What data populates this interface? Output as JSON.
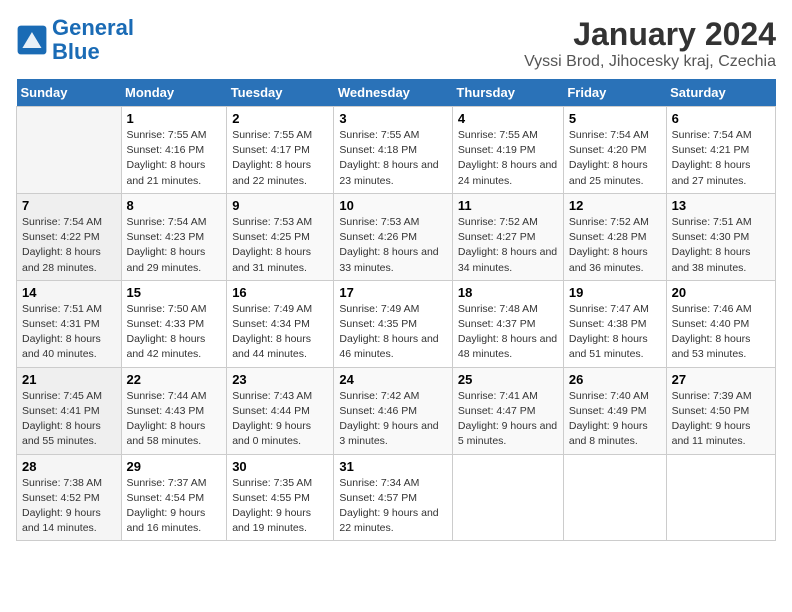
{
  "logo": {
    "line1": "General",
    "line2": "Blue"
  },
  "title": "January 2024",
  "subtitle": "Vyssi Brod, Jihocesky kraj, Czechia",
  "columns": [
    "Sunday",
    "Monday",
    "Tuesday",
    "Wednesday",
    "Thursday",
    "Friday",
    "Saturday"
  ],
  "weeks": [
    [
      {
        "num": "",
        "sunrise": "",
        "sunset": "",
        "daylight": ""
      },
      {
        "num": "1",
        "sunrise": "Sunrise: 7:55 AM",
        "sunset": "Sunset: 4:16 PM",
        "daylight": "Daylight: 8 hours and 21 minutes."
      },
      {
        "num": "2",
        "sunrise": "Sunrise: 7:55 AM",
        "sunset": "Sunset: 4:17 PM",
        "daylight": "Daylight: 8 hours and 22 minutes."
      },
      {
        "num": "3",
        "sunrise": "Sunrise: 7:55 AM",
        "sunset": "Sunset: 4:18 PM",
        "daylight": "Daylight: 8 hours and 23 minutes."
      },
      {
        "num": "4",
        "sunrise": "Sunrise: 7:55 AM",
        "sunset": "Sunset: 4:19 PM",
        "daylight": "Daylight: 8 hours and 24 minutes."
      },
      {
        "num": "5",
        "sunrise": "Sunrise: 7:54 AM",
        "sunset": "Sunset: 4:20 PM",
        "daylight": "Daylight: 8 hours and 25 minutes."
      },
      {
        "num": "6",
        "sunrise": "Sunrise: 7:54 AM",
        "sunset": "Sunset: 4:21 PM",
        "daylight": "Daylight: 8 hours and 27 minutes."
      }
    ],
    [
      {
        "num": "7",
        "sunrise": "Sunrise: 7:54 AM",
        "sunset": "Sunset: 4:22 PM",
        "daylight": "Daylight: 8 hours and 28 minutes."
      },
      {
        "num": "8",
        "sunrise": "Sunrise: 7:54 AM",
        "sunset": "Sunset: 4:23 PM",
        "daylight": "Daylight: 8 hours and 29 minutes."
      },
      {
        "num": "9",
        "sunrise": "Sunrise: 7:53 AM",
        "sunset": "Sunset: 4:25 PM",
        "daylight": "Daylight: 8 hours and 31 minutes."
      },
      {
        "num": "10",
        "sunrise": "Sunrise: 7:53 AM",
        "sunset": "Sunset: 4:26 PM",
        "daylight": "Daylight: 8 hours and 33 minutes."
      },
      {
        "num": "11",
        "sunrise": "Sunrise: 7:52 AM",
        "sunset": "Sunset: 4:27 PM",
        "daylight": "Daylight: 8 hours and 34 minutes."
      },
      {
        "num": "12",
        "sunrise": "Sunrise: 7:52 AM",
        "sunset": "Sunset: 4:28 PM",
        "daylight": "Daylight: 8 hours and 36 minutes."
      },
      {
        "num": "13",
        "sunrise": "Sunrise: 7:51 AM",
        "sunset": "Sunset: 4:30 PM",
        "daylight": "Daylight: 8 hours and 38 minutes."
      }
    ],
    [
      {
        "num": "14",
        "sunrise": "Sunrise: 7:51 AM",
        "sunset": "Sunset: 4:31 PM",
        "daylight": "Daylight: 8 hours and 40 minutes."
      },
      {
        "num": "15",
        "sunrise": "Sunrise: 7:50 AM",
        "sunset": "Sunset: 4:33 PM",
        "daylight": "Daylight: 8 hours and 42 minutes."
      },
      {
        "num": "16",
        "sunrise": "Sunrise: 7:49 AM",
        "sunset": "Sunset: 4:34 PM",
        "daylight": "Daylight: 8 hours and 44 minutes."
      },
      {
        "num": "17",
        "sunrise": "Sunrise: 7:49 AM",
        "sunset": "Sunset: 4:35 PM",
        "daylight": "Daylight: 8 hours and 46 minutes."
      },
      {
        "num": "18",
        "sunrise": "Sunrise: 7:48 AM",
        "sunset": "Sunset: 4:37 PM",
        "daylight": "Daylight: 8 hours and 48 minutes."
      },
      {
        "num": "19",
        "sunrise": "Sunrise: 7:47 AM",
        "sunset": "Sunset: 4:38 PM",
        "daylight": "Daylight: 8 hours and 51 minutes."
      },
      {
        "num": "20",
        "sunrise": "Sunrise: 7:46 AM",
        "sunset": "Sunset: 4:40 PM",
        "daylight": "Daylight: 8 hours and 53 minutes."
      }
    ],
    [
      {
        "num": "21",
        "sunrise": "Sunrise: 7:45 AM",
        "sunset": "Sunset: 4:41 PM",
        "daylight": "Daylight: 8 hours and 55 minutes."
      },
      {
        "num": "22",
        "sunrise": "Sunrise: 7:44 AM",
        "sunset": "Sunset: 4:43 PM",
        "daylight": "Daylight: 8 hours and 58 minutes."
      },
      {
        "num": "23",
        "sunrise": "Sunrise: 7:43 AM",
        "sunset": "Sunset: 4:44 PM",
        "daylight": "Daylight: 9 hours and 0 minutes."
      },
      {
        "num": "24",
        "sunrise": "Sunrise: 7:42 AM",
        "sunset": "Sunset: 4:46 PM",
        "daylight": "Daylight: 9 hours and 3 minutes."
      },
      {
        "num": "25",
        "sunrise": "Sunrise: 7:41 AM",
        "sunset": "Sunset: 4:47 PM",
        "daylight": "Daylight: 9 hours and 5 minutes."
      },
      {
        "num": "26",
        "sunrise": "Sunrise: 7:40 AM",
        "sunset": "Sunset: 4:49 PM",
        "daylight": "Daylight: 9 hours and 8 minutes."
      },
      {
        "num": "27",
        "sunrise": "Sunrise: 7:39 AM",
        "sunset": "Sunset: 4:50 PM",
        "daylight": "Daylight: 9 hours and 11 minutes."
      }
    ],
    [
      {
        "num": "28",
        "sunrise": "Sunrise: 7:38 AM",
        "sunset": "Sunset: 4:52 PM",
        "daylight": "Daylight: 9 hours and 14 minutes."
      },
      {
        "num": "29",
        "sunrise": "Sunrise: 7:37 AM",
        "sunset": "Sunset: 4:54 PM",
        "daylight": "Daylight: 9 hours and 16 minutes."
      },
      {
        "num": "30",
        "sunrise": "Sunrise: 7:35 AM",
        "sunset": "Sunset: 4:55 PM",
        "daylight": "Daylight: 9 hours and 19 minutes."
      },
      {
        "num": "31",
        "sunrise": "Sunrise: 7:34 AM",
        "sunset": "Sunset: 4:57 PM",
        "daylight": "Daylight: 9 hours and 22 minutes."
      },
      {
        "num": "",
        "sunrise": "",
        "sunset": "",
        "daylight": ""
      },
      {
        "num": "",
        "sunrise": "",
        "sunset": "",
        "daylight": ""
      },
      {
        "num": "",
        "sunrise": "",
        "sunset": "",
        "daylight": ""
      }
    ]
  ]
}
